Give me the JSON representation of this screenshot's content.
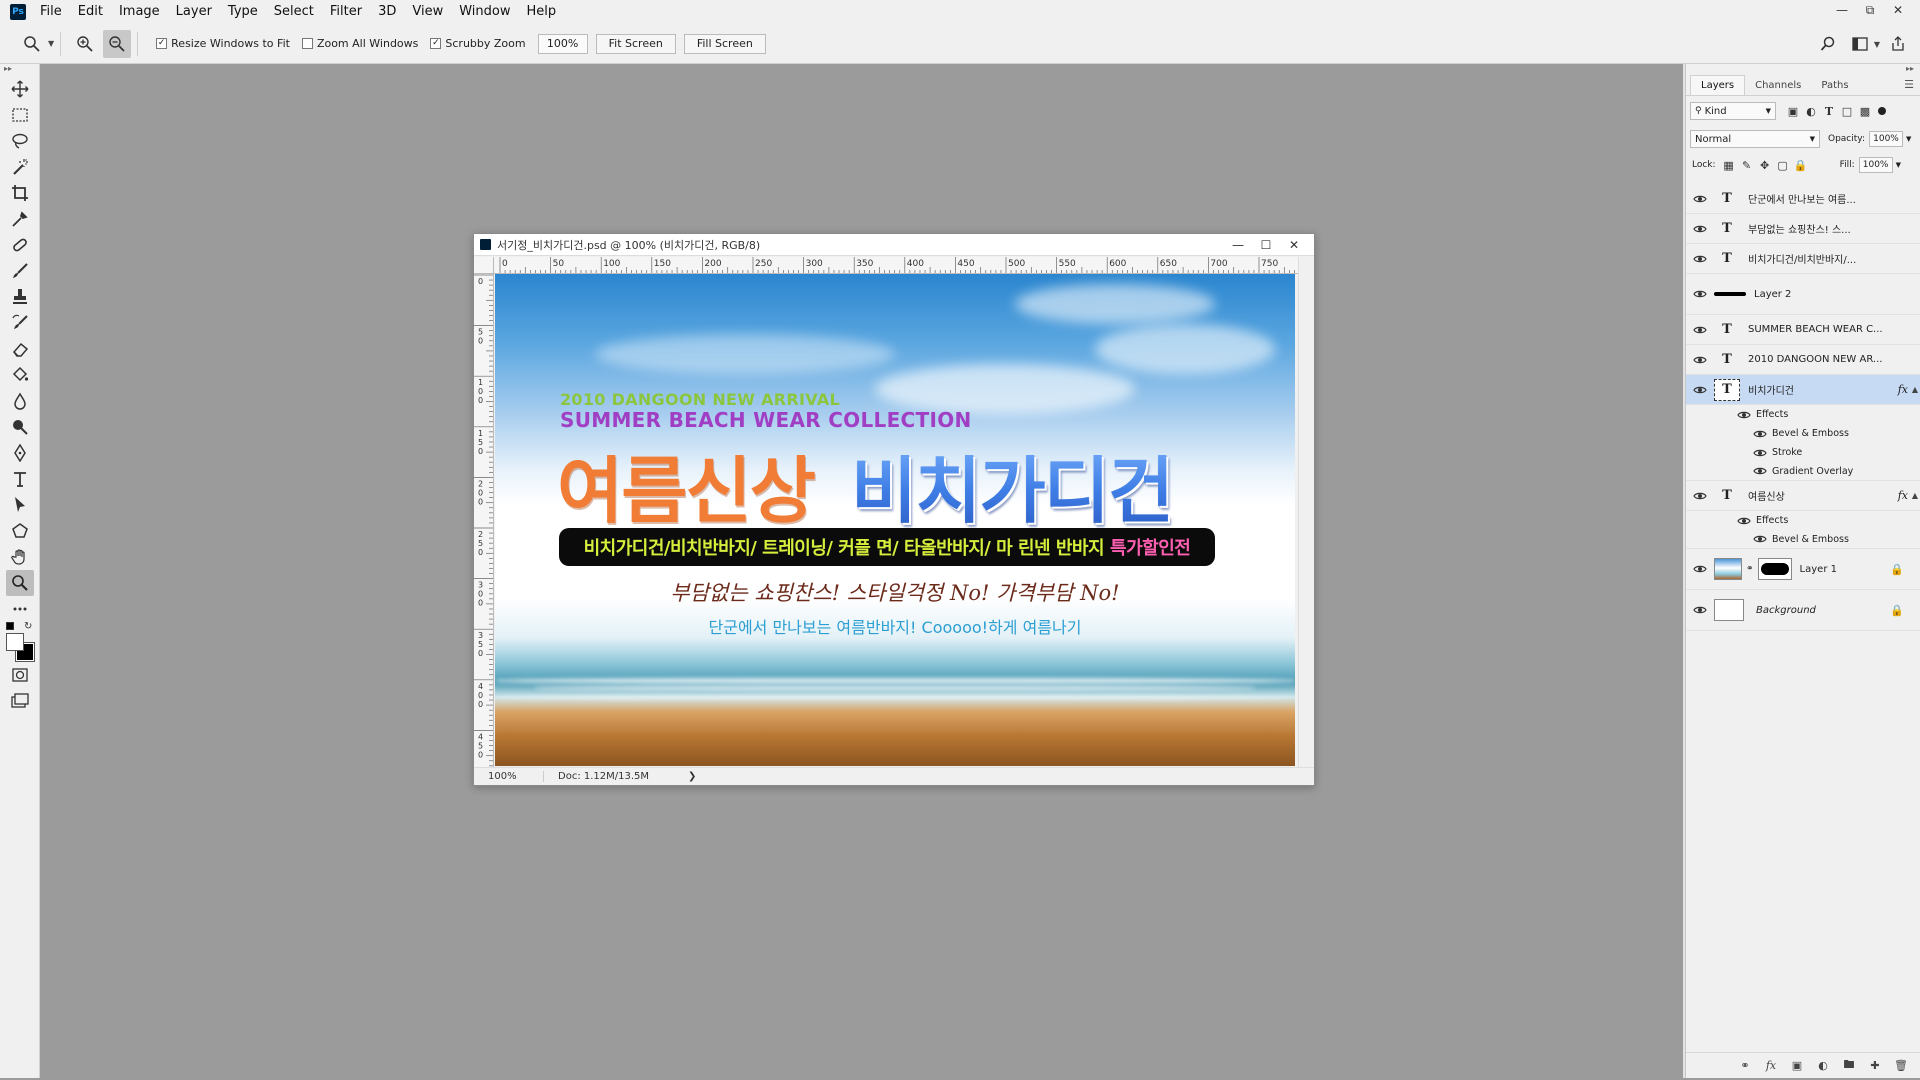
{
  "app": {
    "logo_text": "Ps",
    "menus": [
      "File",
      "Edit",
      "Image",
      "Layer",
      "Type",
      "Select",
      "Filter",
      "3D",
      "View",
      "Window",
      "Help"
    ]
  },
  "options_bar": {
    "zoom_tool_icon": "zoom-icon",
    "resize_windows_label": "Resize Windows to Fit",
    "resize_windows_checked": true,
    "zoom_all_windows_label": "Zoom All Windows",
    "zoom_all_windows_checked": false,
    "scrubby_zoom_label": "Scrubby Zoom",
    "scrubby_zoom_checked": true,
    "zoom_value": "100%",
    "fit_screen_label": "Fit Screen",
    "fill_screen_label": "Fill Screen"
  },
  "document": {
    "title": "서기정_비치가디건.psd @ 100% (비치가디건, RGB/8)",
    "status_zoom": "100%",
    "status_doc": "Doc: 1.12M/13.5M",
    "ruler_h": [
      "0",
      "50",
      "100",
      "150",
      "200",
      "250",
      "300",
      "350",
      "400",
      "450",
      "500",
      "550",
      "600",
      "650",
      "700",
      "750"
    ],
    "ruler_v": [
      "0",
      "5\n0",
      "1\n0\n0",
      "1\n5\n0",
      "2\n0\n0",
      "2\n5\n0",
      "3\n0\n0",
      "3\n5\n0",
      "4\n0\n0",
      "4\n5\n0"
    ]
  },
  "canvas": {
    "line1": "2010 DANGOON NEW ARRIVAL",
    "line2": "SUMMER BEACH WEAR COLLECTION",
    "big1": "여름신상",
    "big2": "비치가디건",
    "pill_text": "비치가디건/비치반바지/ 트레이닝/ 커플 면/ 타올반바지/ 마 린넨 반바지",
    "pill_highlight": "특가할인전",
    "script_line": "부담없는 쇼핑찬스! 스타일걱정 No! 가격부담 No!",
    "sub_line": "단군에서 만나보는 여름반바지! Cooooo!하게 여름나기"
  },
  "panel": {
    "tabs": [
      "Layers",
      "Channels",
      "Paths"
    ],
    "filter_kind": "Kind",
    "blend_mode": "Normal",
    "opacity_label": "Opacity:",
    "opacity_value": "100%",
    "lock_label": "Lock:",
    "fill_label": "Fill:",
    "fill_value": "100%",
    "layers": [
      {
        "name": "단군에서 만나보는 여름..."
      },
      {
        "name": "부담없는 쇼핑찬스! 스..."
      },
      {
        "name": "비치가디건/비치반바지/..."
      },
      {
        "name": "Layer 2"
      },
      {
        "name": "SUMMER BEACH WEAR C..."
      },
      {
        "name": "2010 DANGOON NEW AR..."
      },
      {
        "name": "비치가디건",
        "effects_label": "Effects",
        "effects": [
          "Bevel & Emboss",
          "Stroke",
          "Gradient Overlay"
        ]
      },
      {
        "name": "여름신상",
        "effects_label": "Effects",
        "effects": [
          "Bevel & Emboss"
        ]
      },
      {
        "name": "Layer 1"
      },
      {
        "name": "Background"
      }
    ],
    "fx_label": "fx"
  }
}
